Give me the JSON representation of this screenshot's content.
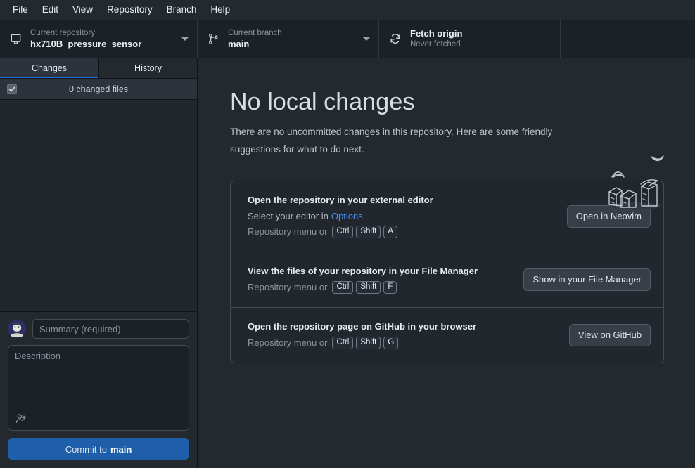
{
  "menubar": {
    "items": [
      {
        "label": "File"
      },
      {
        "label": "Edit"
      },
      {
        "label": "View"
      },
      {
        "label": "Repository"
      },
      {
        "label": "Branch"
      },
      {
        "label": "Help"
      }
    ]
  },
  "toolbar": {
    "repository": {
      "icon": "repo-icon",
      "label": "Current repository",
      "value": "hx710B_pressure_sensor"
    },
    "branch": {
      "icon": "git-branch-icon",
      "label": "Current branch",
      "value": "main"
    },
    "fetch": {
      "icon": "sync-icon",
      "label": "Fetch origin",
      "value": "Never fetched"
    }
  },
  "sidebar": {
    "tabs": [
      {
        "label": "Changes",
        "active": true
      },
      {
        "label": "History",
        "active": false
      }
    ],
    "changes_header": {
      "checkbox_checked": true,
      "count_label": "0 changed files"
    },
    "commit": {
      "avatar_name": "user-avatar",
      "summary_placeholder": "Summary (required)",
      "summary_value": "",
      "description_placeholder": "Description",
      "description_value": "",
      "coauthor_icon": "person-add-icon",
      "button_prefix": "Commit to",
      "button_branch": "main"
    }
  },
  "main": {
    "title": "No local changes",
    "subtitle": "There are no uncommitted changes in this repository. Here are some friendly suggestions for what to do next.",
    "illustration_name": "boxes-and-birds-illustration",
    "suggestions": [
      {
        "title": "Open the repository in your external editor",
        "line1_prefix": "Select your editor in",
        "line1_link": "Options",
        "line2_prefix": "Repository menu or",
        "keys": [
          "Ctrl",
          "Shift",
          "A"
        ],
        "button": "Open in Neovim",
        "button_name": "open-in-neovim-button"
      },
      {
        "title": "View the files of your repository in your File Manager",
        "line1_prefix": "",
        "line1_link": "",
        "line2_prefix": "Repository menu or",
        "keys": [
          "Ctrl",
          "Shift",
          "F"
        ],
        "button": "Show in your File Manager",
        "button_name": "show-in-file-manager-button"
      },
      {
        "title": "Open the repository page on GitHub in your browser",
        "line1_prefix": "",
        "line1_link": "",
        "line2_prefix": "Repository menu or",
        "keys": [
          "Ctrl",
          "Shift",
          "G"
        ],
        "button": "View on GitHub",
        "button_name": "view-on-github-button"
      }
    ]
  },
  "colors": {
    "accent_blue": "#1f6feb",
    "link_blue": "#4a8ef0",
    "commit_button": "#1f5fa9",
    "background": "#24292e",
    "panel": "#22272e",
    "toolbar": "#1c2128",
    "border": "#444c56"
  }
}
